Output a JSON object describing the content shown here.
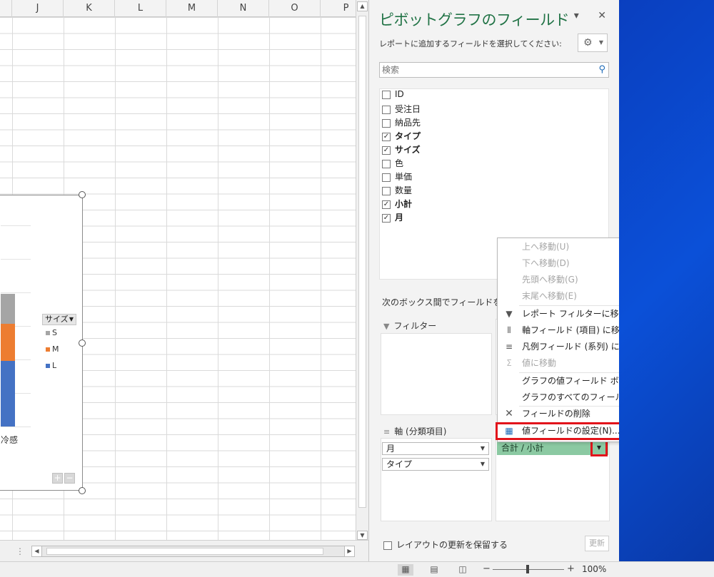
{
  "sheet": {
    "columns": [
      "J",
      "K",
      "L",
      "M",
      "N",
      "O",
      "P"
    ]
  },
  "chart": {
    "legend_title": "サイズ",
    "legend_items": [
      {
        "label": "S",
        "color": "#a5a5a5"
      },
      {
        "label": "M",
        "color": "#ed7d31"
      },
      {
        "label": "L",
        "color": "#4472c4"
      }
    ],
    "category_label": "冷感",
    "expand_label": "+",
    "collapse_label": "−"
  },
  "panel": {
    "title": "ピボットグラフのフィールド",
    "subtitle": "レポートに追加するフィールドを選択してください:",
    "search_placeholder": "検索",
    "fields": [
      {
        "label": "ID",
        "checked": false
      },
      {
        "label": "受注日",
        "checked": false
      },
      {
        "label": "納品先",
        "checked": false
      },
      {
        "label": "タイプ",
        "checked": true
      },
      {
        "label": "サイズ",
        "checked": true
      },
      {
        "label": "色",
        "checked": false
      },
      {
        "label": "単価",
        "checked": false
      },
      {
        "label": "数量",
        "checked": false
      },
      {
        "label": "小計",
        "checked": true
      },
      {
        "label": "月",
        "checked": true
      }
    ],
    "drag_hint": "次のボックス間でフィールドをドラッグしてください:",
    "filter_label": "フィルター",
    "axis_label": "軸 (分類項目)",
    "axis_items": [
      "月",
      "タイプ"
    ],
    "value_item": "合計 / 小計",
    "defer_label": "レイアウトの更新を保留する",
    "update_label": "更新"
  },
  "context_menu": {
    "items": [
      {
        "label": "上へ移動(U)",
        "disabled": true,
        "icon": ""
      },
      {
        "label": "下へ移動(D)",
        "disabled": true,
        "icon": ""
      },
      {
        "label": "先頭へ移動(G)",
        "disabled": true,
        "icon": ""
      },
      {
        "label": "末尾へ移動(E)",
        "disabled": true,
        "icon": ""
      },
      {
        "label": "レポート フィルターに移動",
        "disabled": false,
        "icon": "filter-icon"
      },
      {
        "label": "軸フィールド (項目) に移動",
        "disabled": false,
        "icon": "axis-icon"
      },
      {
        "label": "凡例フィールド (系列) に移動",
        "disabled": false,
        "icon": "legend-icon"
      },
      {
        "label": "値に移動",
        "disabled": true,
        "icon": "sigma-icon"
      },
      {
        "label": "グラフの値フィールド ボタンを非表示にする",
        "disabled": false,
        "icon": ""
      },
      {
        "label": "グラフのすべてのフィールド ボタンを非表示にする",
        "disabled": false,
        "icon": ""
      },
      {
        "label": "フィールドの削除",
        "disabled": false,
        "icon": "remove-icon"
      },
      {
        "label": "値フィールドの設定(N)...",
        "disabled": false,
        "icon": "value-settings-icon"
      }
    ]
  },
  "status_bar": {
    "zoom_minus": "−",
    "zoom_plus": "+",
    "zoom_level": "100%"
  }
}
